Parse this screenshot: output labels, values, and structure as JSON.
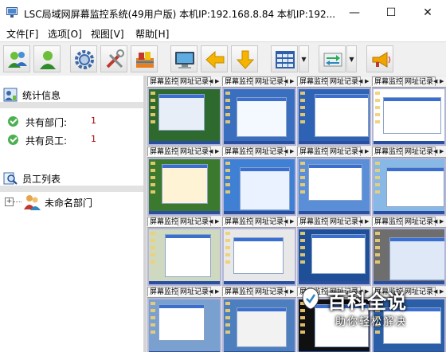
{
  "window": {
    "title": "LSC局域网屏幕监控系统(49用户版)   本机IP:192.168.8.84   本机IP:192...",
    "minimize": "—",
    "maximize": "☐",
    "close": "✕"
  },
  "menu": [
    "文件[F]",
    "选项[O]",
    "视图[V]",
    "帮助[H]"
  ],
  "toolbar": {
    "buttons": [
      "users-add-icon",
      "user-icon",
      "gear-icon",
      "tools-icon",
      "books-icon",
      "monitor-icon",
      "arrow-left-icon",
      "arrow-down-icon",
      "grid-layout-icon",
      "transfer-icon",
      "megaphone-icon"
    ],
    "dropdown_arrow": "▼"
  },
  "stats": {
    "title": "统计信息",
    "departments_label": "共有部门:",
    "departments_value": "1",
    "employees_label": "共有员工:",
    "employees_value": "1"
  },
  "employees": {
    "title": "员工列表",
    "expander": "+",
    "tree_item": "未命名部门"
  },
  "grid": {
    "tab_primary": "屏幕监控",
    "tab_secondary": "网址记录",
    "arrow_left": "◀",
    "arrow_right": "▶",
    "cells": [
      {
        "desktop": "#2e6a2e",
        "window": "#e7eef8"
      },
      {
        "desktop": "#3a6fc0",
        "window": "#f4f8ff"
      },
      {
        "desktop": "#2d62b5",
        "window": "#ffffff"
      },
      {
        "desktop": "#ffffff",
        "window": "#ffffff"
      },
      {
        "desktop": "#3b7a2e",
        "window": "#fff3d6"
      },
      {
        "desktop": "#3f7fd4",
        "window": "#eaf2ff"
      },
      {
        "desktop": "#5a8fd8",
        "window": "#ffffff"
      },
      {
        "desktop": "#88b8e6",
        "window": "#ffffff"
      },
      {
        "desktop": "#cfd9c0",
        "window": "#ffffff"
      },
      {
        "desktop": "#e8e8e8",
        "window": "#ffffff"
      },
      {
        "desktop": "#1f4f96",
        "window": "#ffffff"
      },
      {
        "desktop": "#6e6e6e",
        "window": "#dfe8f6"
      },
      {
        "desktop": "#7aa0d0",
        "window": "#ffffff"
      },
      {
        "desktop": "#4d7fbf",
        "window": "#f2f2f2"
      },
      {
        "desktop": "#101010",
        "window": "#ffffff"
      },
      {
        "desktop": "#2a5fa8",
        "window": "#ffffff"
      }
    ]
  },
  "watermark": {
    "main": "百科全说",
    "sub": "助你轻松解决"
  }
}
